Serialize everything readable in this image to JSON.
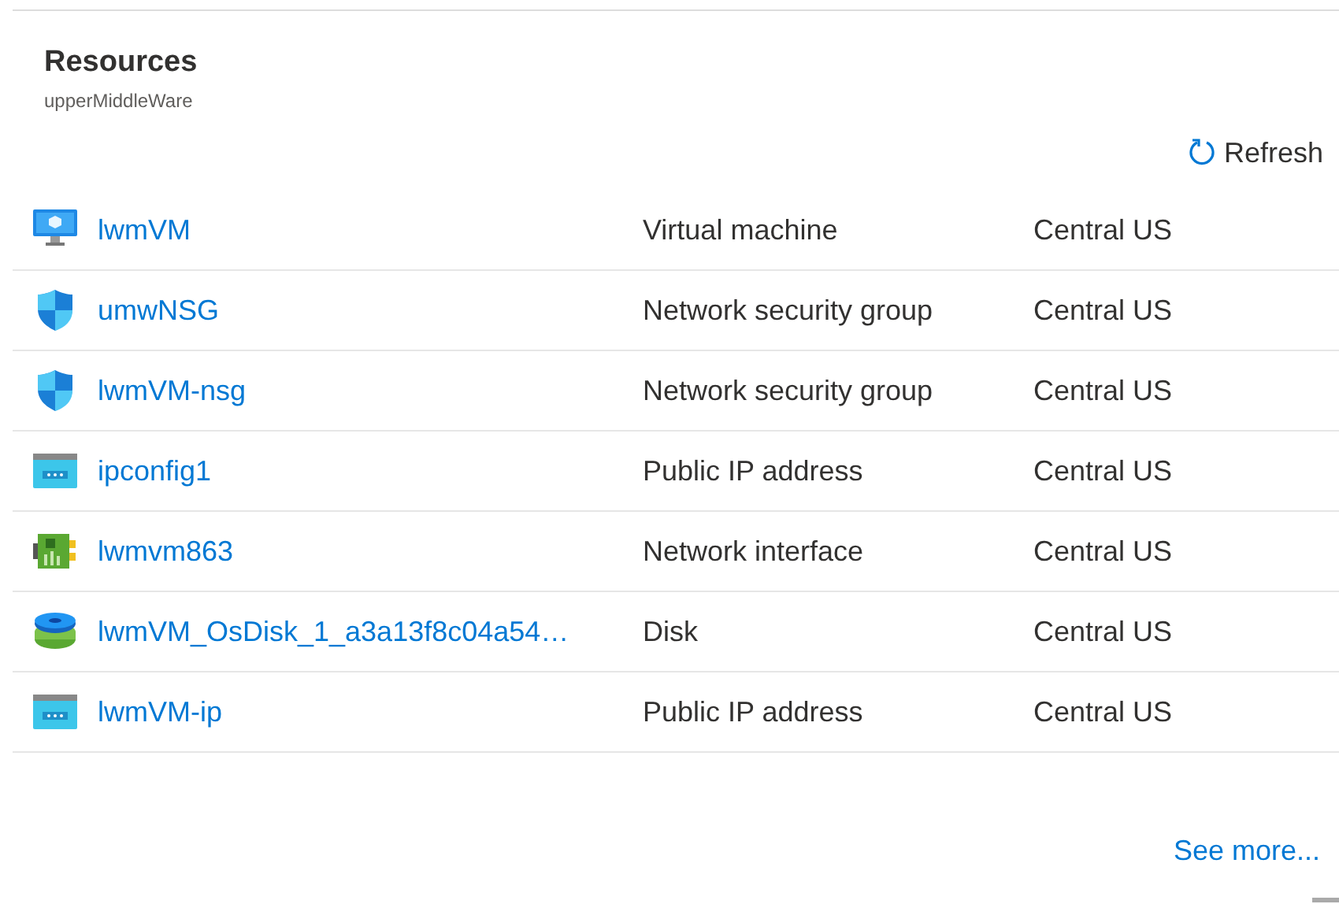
{
  "panel": {
    "title": "Resources",
    "subtitle": "upperMiddleWare"
  },
  "refresh": {
    "label": "Refresh"
  },
  "rows": [
    {
      "kind": "vm",
      "name": "lwmVM",
      "type": "Virtual machine",
      "location": "Central US"
    },
    {
      "kind": "shield",
      "name": "umwNSG",
      "type": "Network security group",
      "location": "Central US"
    },
    {
      "kind": "shield",
      "name": "lwmVM-nsg",
      "type": "Network security group",
      "location": "Central US"
    },
    {
      "kind": "ip",
      "name": "ipconfig1",
      "type": "Public IP address",
      "location": "Central US"
    },
    {
      "kind": "nic",
      "name": "lwmvm863",
      "type": "Network interface",
      "location": "Central US"
    },
    {
      "kind": "disk",
      "name": "lwmVM_OsDisk_1_a3a13f8c04a54…",
      "type": "Disk",
      "location": "Central US"
    },
    {
      "kind": "ip",
      "name": "lwmVM-ip",
      "type": "Public IP address",
      "location": "Central US"
    }
  ],
  "see_more": {
    "label": "See more..."
  }
}
